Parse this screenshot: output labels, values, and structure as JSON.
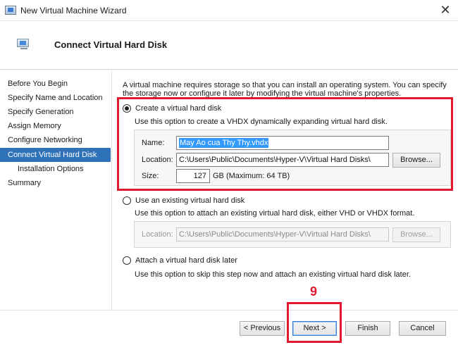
{
  "window": {
    "title": "New Virtual Machine Wizard",
    "close_glyph": "✕"
  },
  "header": {
    "title": "Connect Virtual Hard Disk"
  },
  "sidebar": {
    "items": [
      {
        "label": "Before You Begin"
      },
      {
        "label": "Specify Name and Location"
      },
      {
        "label": "Specify Generation"
      },
      {
        "label": "Assign Memory"
      },
      {
        "label": "Configure Networking"
      },
      {
        "label": "Connect Virtual Hard Disk"
      },
      {
        "label": "Installation Options"
      },
      {
        "label": "Summary"
      }
    ],
    "active_index": 5
  },
  "intro": "A virtual machine requires storage so that you can install an operating system. You can specify the storage now or configure it later by modifying the virtual machine's properties.",
  "options": {
    "create": {
      "label": "Create a virtual hard disk",
      "description": "Use this option to create a VHDX dynamically expanding virtual hard disk.",
      "selected": true,
      "name_label": "Name:",
      "name_value": "May Ao cua Thy Thy.vhdx",
      "location_label": "Location:",
      "location_value": "C:\\Users\\Public\\Documents\\Hyper-V\\Virtual Hard Disks\\",
      "browse_label": "Browse...",
      "size_label": "Size:",
      "size_value": "127",
      "size_unit": "GB (Maximum: 64 TB)"
    },
    "existing": {
      "label": "Use an existing virtual hard disk",
      "description": "Use this option to attach an existing virtual hard disk, either VHD or VHDX format.",
      "selected": false,
      "location_label": "Location:",
      "location_value": "C:\\Users\\Public\\Documents\\Hyper-V\\Virtual Hard Disks\\",
      "browse_label": "Browse..."
    },
    "later": {
      "label": "Attach a virtual hard disk later",
      "description": "Use this option to skip this step now and attach an existing virtual hard disk later.",
      "selected": false
    }
  },
  "buttons": {
    "previous": "< Previous",
    "next": "Next >",
    "finish": "Finish",
    "cancel": "Cancel"
  },
  "annotation": {
    "step_number": "9",
    "color": "#e0192f"
  }
}
